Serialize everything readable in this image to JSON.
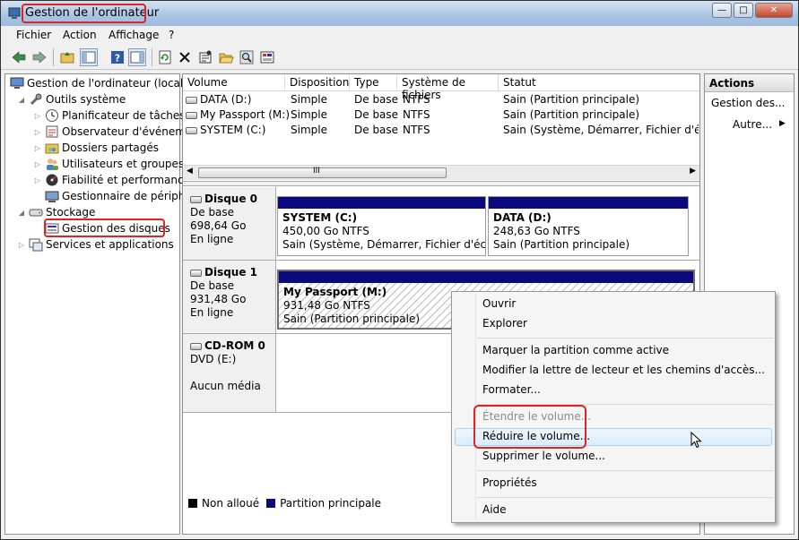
{
  "window": {
    "title": "Gestion de l'ordinateur"
  },
  "window_buttons": {
    "minimize": "—",
    "maximize": "□",
    "close": "✕"
  },
  "menu": [
    "Fichier",
    "Action",
    "Affichage",
    "?"
  ],
  "tree": {
    "root": "Gestion de l'ordinateur (local)",
    "items": [
      "Outils système",
      "Planificateur de tâches",
      "Observateur d'événeme",
      "Dossiers partagés",
      "Utilisateurs et groupes l",
      "Fiabilité et performance",
      "Gestionnaire de périphé",
      "Stockage",
      "Gestion des disques",
      "Services et applications"
    ]
  },
  "table": {
    "headers": [
      "Volume",
      "Disposition",
      "Type",
      "Système de fichiers",
      "Statut"
    ],
    "rows": [
      [
        "DATA (D:)",
        "Simple",
        "De base",
        "NTFS",
        "Sain (Partition principale)"
      ],
      [
        "My Passport (M:)",
        "Simple",
        "De base",
        "NTFS",
        "Sain (Partition principale)"
      ],
      [
        "SYSTEM (C:)",
        "Simple",
        "De base",
        "NTFS",
        "Sain (Système, Démarrer, Fichier d'échang"
      ]
    ],
    "scroll_label": "III"
  },
  "disks": [
    {
      "name": "Disque 0",
      "type": "De base",
      "size": "698,64 Go",
      "status": "En ligne",
      "partitions": [
        {
          "name": "SYSTEM  (C:)",
          "size": "450,00 Go NTFS",
          "status": "Sain (Système, Démarrer, Fichier d'échang"
        },
        {
          "name": "DATA  (D:)",
          "size": "248,63 Go NTFS",
          "status": "Sain (Partition principale)"
        }
      ]
    },
    {
      "name": "Disque 1",
      "type": "De base",
      "size": "931,48 Go",
      "status": "En ligne",
      "partitions": [
        {
          "name": "My Passport  (M:)",
          "size": "931,48 Go NTFS",
          "status": "Sain (Partition principale)"
        }
      ]
    },
    {
      "name": "CD-ROM 0",
      "type": "DVD (E:)",
      "media": "Aucun média"
    }
  ],
  "legend": {
    "unallocated": "Non alloué",
    "primary": "Partition principale"
  },
  "actions": {
    "title": "Actions",
    "item1": "Gestion des...",
    "item2": "Autre..."
  },
  "context_menu": {
    "open": "Ouvrir",
    "explore": "Explorer",
    "mark_active": "Marquer la partition comme active",
    "change_letter": "Modifier la lettre de lecteur et les chemins d'accès...",
    "format": "Formater...",
    "extend": "Étendre le volume...",
    "shrink": "Réduire le volume...",
    "delete": "Supprimer le volume...",
    "properties": "Propriétés",
    "help": "Aide"
  },
  "colors": {
    "partition_band": "#0a0a7c",
    "unallocated": "#000000",
    "highlight": "#e32222"
  }
}
